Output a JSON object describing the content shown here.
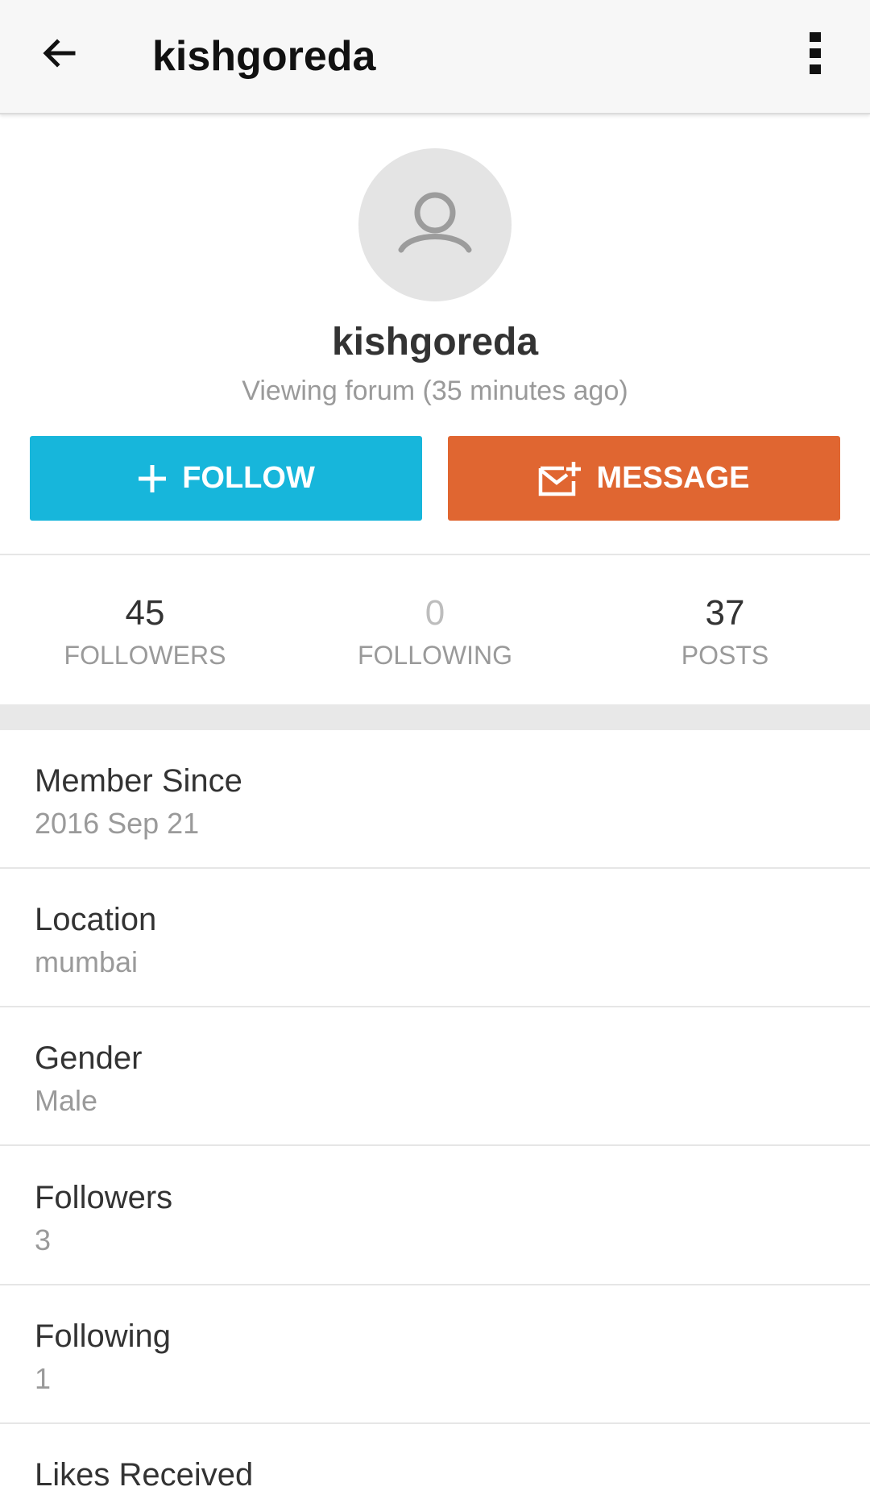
{
  "header": {
    "title": "kishgoreda",
    "back_icon": "arrow-left-icon",
    "more_icon": "more-vert-icon"
  },
  "profile": {
    "name": "kishgoreda",
    "status": "Viewing forum (35 minutes ago)",
    "avatar_icon": "person-outline-icon"
  },
  "actions": {
    "follow_label": "FOLLOW",
    "follow_icon": "plus-icon",
    "follow_color": "#17b6db",
    "message_label": "MESSAGE",
    "message_icon": "mail-add-icon",
    "message_color": "#e06631"
  },
  "stats": [
    {
      "value": "45",
      "label": "FOLLOWERS"
    },
    {
      "value": "0",
      "label": "FOLLOWING"
    },
    {
      "value": "37",
      "label": "POSTS"
    }
  ],
  "info": [
    {
      "label": "Member Since",
      "value": "2016 Sep 21"
    },
    {
      "label": "Location",
      "value": "mumbai"
    },
    {
      "label": "Gender",
      "value": "Male"
    },
    {
      "label": "Followers",
      "value": "3"
    },
    {
      "label": "Following",
      "value": "1"
    },
    {
      "label": "Likes Received",
      "value": ""
    }
  ]
}
